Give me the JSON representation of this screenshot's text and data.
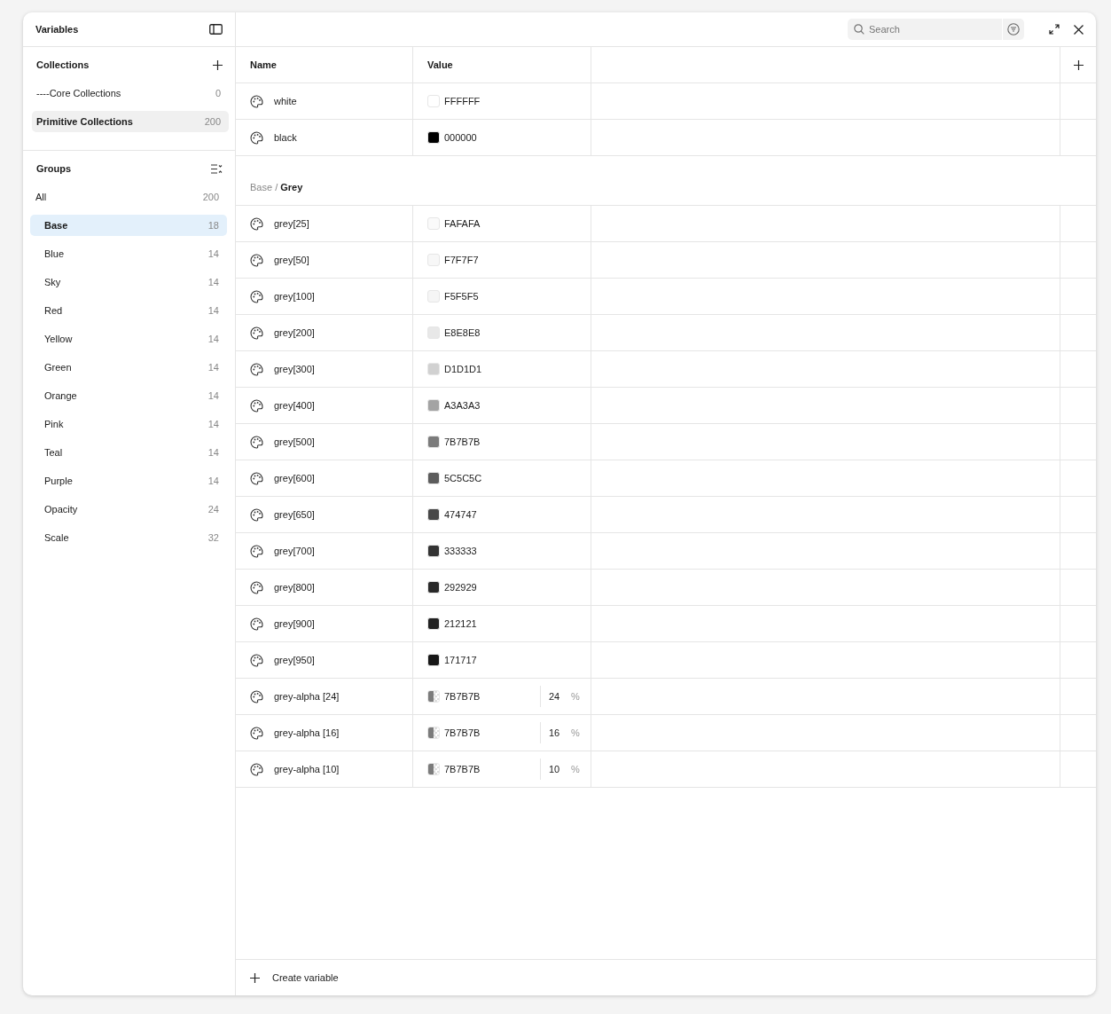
{
  "sidebar": {
    "title": "Variables",
    "collections": {
      "title": "Collections",
      "items": [
        {
          "label": "----Core Collections",
          "count": "0",
          "selected": false
        },
        {
          "label": "Primitive Collections",
          "count": "200",
          "selected": true
        }
      ]
    },
    "groups": {
      "title": "Groups",
      "items": [
        {
          "label": "All",
          "count": "200",
          "selected": false
        },
        {
          "label": "Base",
          "count": "18",
          "selected": true
        },
        {
          "label": "Blue",
          "count": "14",
          "selected": false
        },
        {
          "label": "Sky",
          "count": "14",
          "selected": false
        },
        {
          "label": "Red",
          "count": "14",
          "selected": false
        },
        {
          "label": "Yellow",
          "count": "14",
          "selected": false
        },
        {
          "label": "Green",
          "count": "14",
          "selected": false
        },
        {
          "label": "Orange",
          "count": "14",
          "selected": false
        },
        {
          "label": "Pink",
          "count": "14",
          "selected": false
        },
        {
          "label": "Teal",
          "count": "14",
          "selected": false
        },
        {
          "label": "Purple",
          "count": "14",
          "selected": false
        },
        {
          "label": "Opacity",
          "count": "24",
          "selected": false
        },
        {
          "label": "Scale",
          "count": "32",
          "selected": false
        }
      ]
    }
  },
  "search": {
    "placeholder": "Search"
  },
  "table": {
    "columns": [
      "Name",
      "Value"
    ],
    "sections": [
      {
        "rows": [
          {
            "kind": "solid",
            "name": "white",
            "value": "FFFFFF",
            "color": "#ffffff"
          },
          {
            "kind": "solid",
            "name": "black",
            "value": "000000",
            "color": "#000000"
          }
        ]
      },
      {
        "path": "Base / **Grey**",
        "rows": [
          {
            "kind": "solid",
            "name": "grey[25]",
            "value": "FAFAFA",
            "color": "#fafafa"
          },
          {
            "kind": "solid",
            "name": "grey[50]",
            "value": "F7F7F7",
            "color": "#f7f7f7"
          },
          {
            "kind": "solid",
            "name": "grey[100]",
            "value": "F5F5F5",
            "color": "#f5f5f5"
          },
          {
            "kind": "solid",
            "name": "grey[200]",
            "value": "E8E8E8",
            "color": "#e8e8e8"
          },
          {
            "kind": "solid",
            "name": "grey[300]",
            "value": "D1D1D1",
            "color": "#d1d1d1"
          },
          {
            "kind": "solid",
            "name": "grey[400]",
            "value": "A3A3A3",
            "color": "#a3a3a3"
          },
          {
            "kind": "solid",
            "name": "grey[500]",
            "value": "7B7B7B",
            "color": "#7b7b7b"
          },
          {
            "kind": "solid",
            "name": "grey[600]",
            "value": "5C5C5C",
            "color": "#5c5c5c"
          },
          {
            "kind": "solid",
            "name": "grey[650]",
            "value": "474747",
            "color": "#474747"
          },
          {
            "kind": "solid",
            "name": "grey[700]",
            "value": "333333",
            "color": "#333333"
          },
          {
            "kind": "solid",
            "name": "grey[800]",
            "value": "292929",
            "color": "#292929"
          },
          {
            "kind": "solid",
            "name": "grey[900]",
            "value": "212121",
            "color": "#212121"
          },
          {
            "kind": "solid",
            "name": "grey[950]",
            "value": "171717",
            "color": "#171717"
          },
          {
            "kind": "alpha",
            "name": "grey-alpha [24]",
            "value": "7B7B7B",
            "color": "#7b7b7b",
            "opacity": "24",
            "unit": "%"
          },
          {
            "kind": "alpha",
            "name": "grey-alpha [16]",
            "value": "7B7B7B",
            "color": "#7b7b7b",
            "opacity": "16",
            "unit": "%"
          },
          {
            "kind": "alpha",
            "name": "grey-alpha [10]",
            "value": "7B7B7B",
            "color": "#7b7b7b",
            "opacity": "10",
            "unit": "%"
          }
        ]
      }
    ]
  },
  "footer": {
    "create_label": "Create variable"
  }
}
